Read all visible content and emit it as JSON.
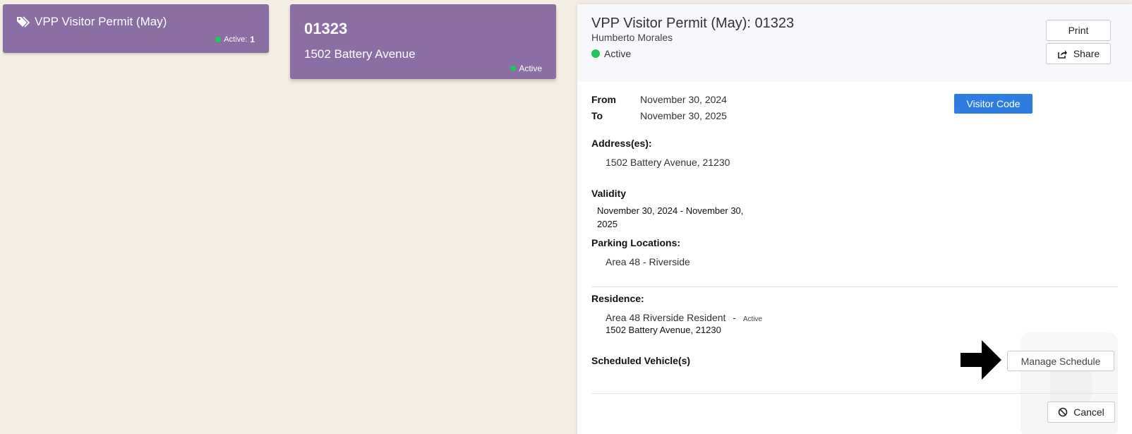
{
  "type_card": {
    "title": "VPP Visitor Permit (May)",
    "active_label": "Active:",
    "active_count": "1",
    "icon": "tags-icon"
  },
  "permit_card": {
    "number": "01323",
    "address": "1502 Battery Avenue",
    "status": "Active"
  },
  "panel": {
    "title": "VPP Visitor Permit (May): 01323",
    "owner": "Humberto Morales",
    "status": "Active",
    "print_label": "Print",
    "share_label": "Share",
    "visitor_code_label": "Visitor Code",
    "from_label": "From",
    "from_value": "November 30, 2024",
    "to_label": "To",
    "to_value": "November 30, 2025",
    "addresses_label": "Address(es):",
    "address_value": "1502 Battery Avenue, 21230",
    "validity_label": "Validity",
    "validity_line1": "November 30, 2024 - November 30,",
    "validity_line2": "2025",
    "parking_label": "Parking Locations:",
    "parking_value": "Area 48 - Riverside",
    "residence_label": "Residence:",
    "residence_name": "Area 48 Riverside Resident",
    "residence_sep": "-",
    "residence_status": "Active",
    "residence_address": "1502 Battery Avenue, 21230",
    "scheduled_label": "Scheduled Vehicle(s)",
    "manage_label": "Manage Schedule",
    "cancel_label": "Cancel"
  },
  "colors": {
    "card_purple": "#8b6fa4",
    "status_green": "#22c55e",
    "primary_blue": "#2f7de1",
    "background": "#f4ede3"
  }
}
